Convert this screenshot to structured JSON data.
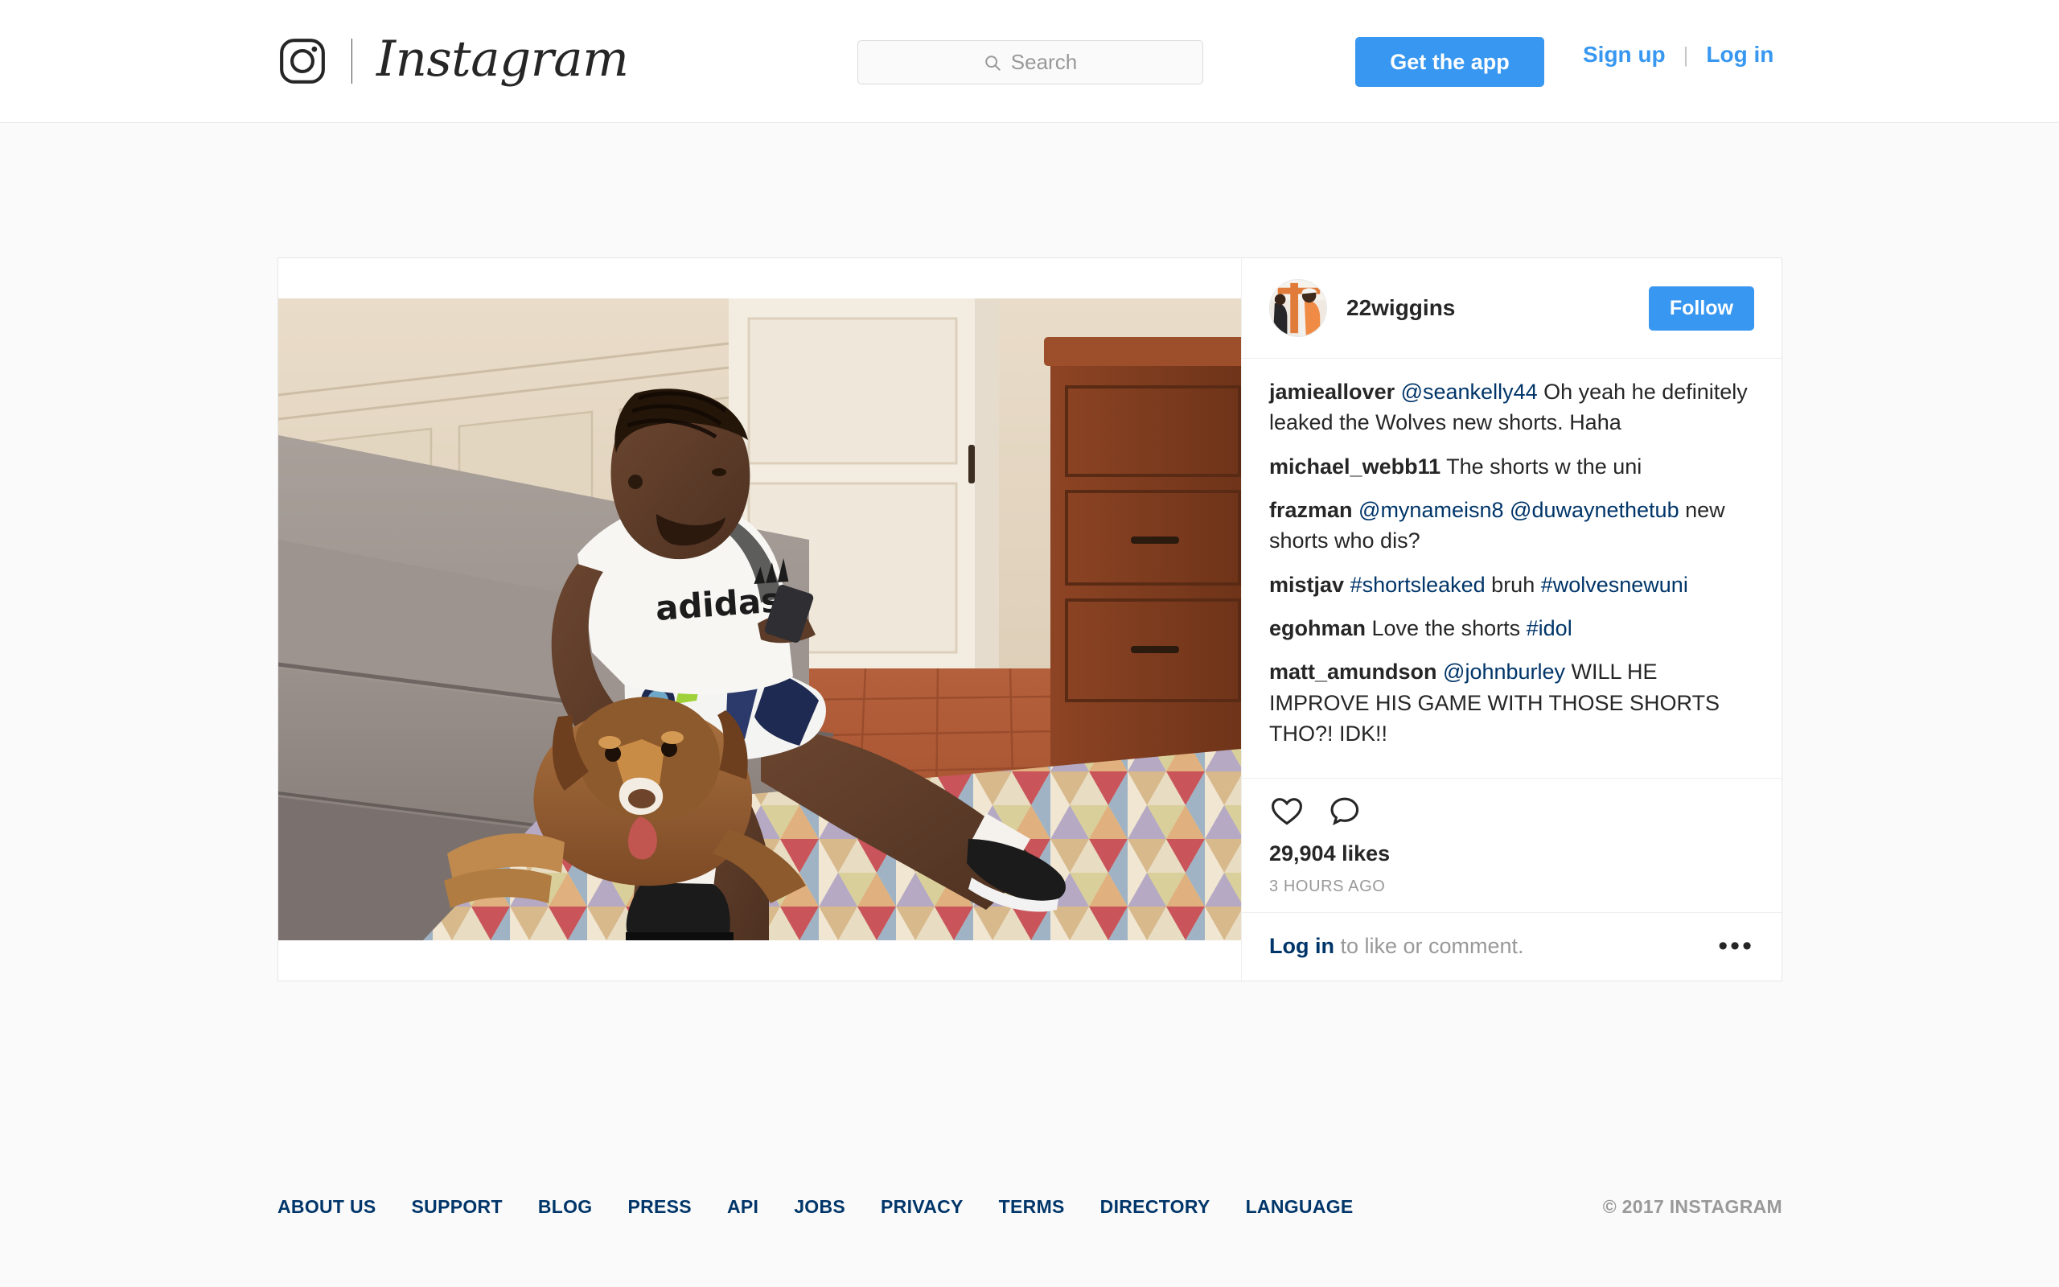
{
  "header": {
    "brand_name": "Instagram",
    "logo_icon": "instagram-camera-icon",
    "search": {
      "icon": "search-icon",
      "placeholder": "Search",
      "value": ""
    },
    "get_app_label": "Get the app",
    "signup_label": "Sign up",
    "separator": "|",
    "login_label": "Log in"
  },
  "post": {
    "username": "22wiggins",
    "avatar_alt": "22wiggins profile picture",
    "follow_label": "Follow",
    "likes": "29,904 likes",
    "timestamp": "3 HOURS AGO",
    "like_icon": "heart-icon",
    "comment_icon": "speech-bubble-icon",
    "more_icon": "more-options-icon",
    "more_label": "•••",
    "login_prompt_link": "Log in",
    "login_prompt_rest": " to like or comment.",
    "comments": [
      {
        "user": "jamieallover",
        "parts": [
          {
            "type": "mention",
            "text": "@seankelly44"
          },
          {
            "type": "text",
            "text": " Oh yeah he definitely leaked the Wolves new shorts. Haha"
          }
        ]
      },
      {
        "user": "michael_webb11",
        "parts": [
          {
            "type": "text",
            "text": " The shorts w the uni"
          }
        ]
      },
      {
        "user": "frazman",
        "parts": [
          {
            "type": "mention",
            "text": "@mynameisn8"
          },
          {
            "type": "text",
            "text": " "
          },
          {
            "type": "mention",
            "text": "@duwaynethetub"
          },
          {
            "type": "text",
            "text": " new shorts who dis?"
          }
        ]
      },
      {
        "user": "mistjav",
        "parts": [
          {
            "type": "hashtag",
            "text": "#shortsleaked"
          },
          {
            "type": "text",
            "text": " bruh "
          },
          {
            "type": "hashtag",
            "text": "#wolvesnewuni"
          }
        ]
      },
      {
        "user": "egohman",
        "parts": [
          {
            "type": "text",
            "text": " Love the shorts "
          },
          {
            "type": "hashtag",
            "text": "#idol"
          }
        ]
      },
      {
        "user": "matt_amundson",
        "parts": [
          {
            "type": "mention",
            "text": "@johnburley"
          },
          {
            "type": "text",
            "text": " WILL HE IMPROVE HIS GAME WITH THOSE SHORTS THO?! IDK!!"
          }
        ]
      }
    ],
    "photo": {
      "alt": "Man in white adidas shirt and navy shorts sitting on a grey couch with a brown dog, colorful triangle patterned rug on terracotta tile floor"
    }
  },
  "footer": {
    "links": [
      "ABOUT US",
      "SUPPORT",
      "BLOG",
      "PRESS",
      "API",
      "JOBS",
      "PRIVACY",
      "TERMS",
      "DIRECTORY",
      "LANGUAGE"
    ],
    "copyright": "© 2017 INSTAGRAM"
  },
  "colors": {
    "accent_blue": "#3897f0",
    "link_navy": "#003569",
    "text_primary": "#262626",
    "text_muted": "#999999",
    "page_bg": "#fafafa"
  }
}
